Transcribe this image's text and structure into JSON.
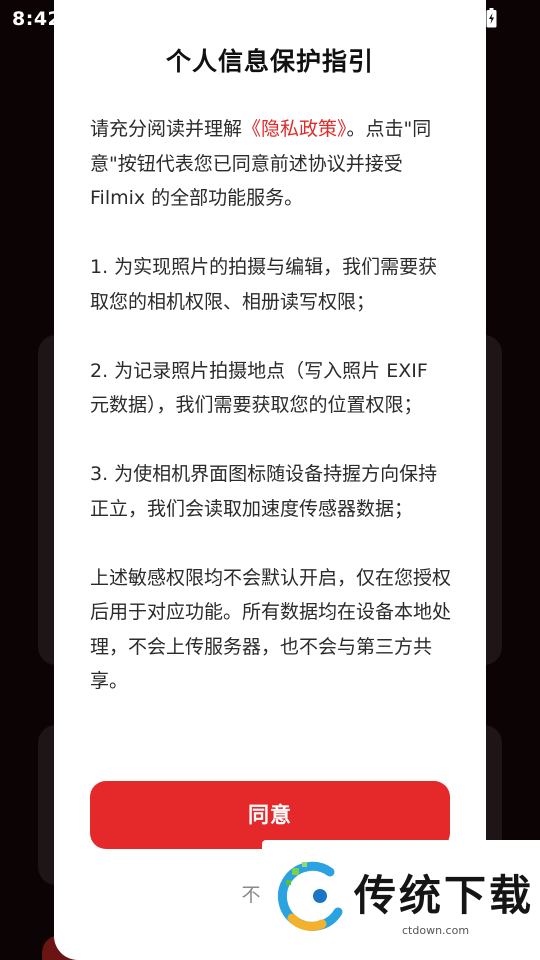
{
  "status_bar": {
    "time": "8:42",
    "app_icon": "photo-app-icon",
    "battery_icon": "battery-charging-icon"
  },
  "dialog": {
    "title": "个人信息保护指引",
    "intro_prefix": "请充分阅读并理解",
    "privacy_link": "《隐私政策》",
    "intro_suffix": "。点击\"同意\"按钮代表您已同意前述协议并接受 Filmix 的全部功能服务。",
    "item_1": "1. 为实现照片的拍摄与编辑，我们需要获取您的相机权限、相册读写权限；",
    "item_2": "2. 为记录照片拍摄地点（写入照片 EXIF 元数据），我们需要获取您的位置权限；",
    "item_3": "3. 为使相机界面图标随设备持握方向保持正立，我们会读取加速度传感器数据；",
    "closing": "上述敏感权限均不会默认开启，仅在您授权后用于对应功能。所有数据均在设备本地处理，不会上传服务器，也不会与第三方共享。",
    "agree_label": "同意",
    "disagree_label": "不同意"
  },
  "watermark": {
    "name": "传统下载",
    "url": "ctdown.com"
  },
  "colors": {
    "accent_red": "#e5292b",
    "link_red": "#e02a2a",
    "background_dark": "#0c0404"
  }
}
